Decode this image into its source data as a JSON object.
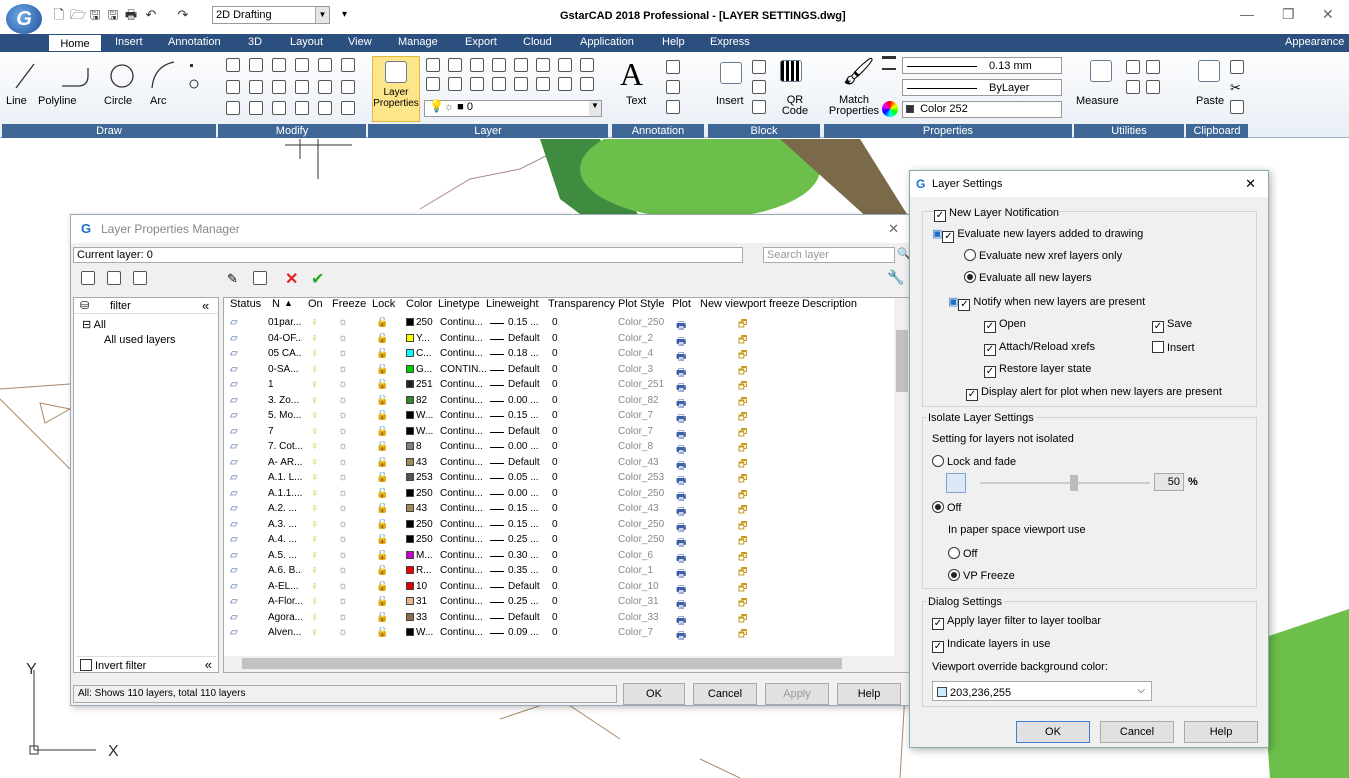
{
  "app": {
    "window_title": "GstarCAD 2018 Professional - [LAYER SETTINGS.dwg]",
    "workspace": "2D Drafting",
    "logo": "G"
  },
  "tabs": [
    "Home",
    "Insert",
    "Annotation",
    "3D",
    "Layout",
    "View",
    "Manage",
    "Export",
    "Cloud",
    "Application",
    "Help",
    "Express"
  ],
  "appearance": "Appearance",
  "ribbon": {
    "draw": {
      "label": "Draw",
      "items": [
        "Line",
        "Polyline",
        "Circle",
        "Arc"
      ]
    },
    "modify": {
      "label": "Modify"
    },
    "layer": {
      "label": "Layer",
      "button": "Layer Properties",
      "layer_value": "0"
    },
    "annotation": {
      "label": "Annotation",
      "text": "Text"
    },
    "block": {
      "label": "Block",
      "insert": "Insert",
      "qr": "QR Code"
    },
    "properties": {
      "label": "Properties",
      "match": "Match Properties",
      "lineweight": "0.13 mm",
      "linetype": "ByLayer",
      "color": "Color 252"
    },
    "utilities": {
      "label": "Utilities",
      "measure": "Measure"
    },
    "clipboard": {
      "label": "Clipboard",
      "paste": "Paste"
    }
  },
  "lpm": {
    "title": "Layer Properties Manager",
    "current_layer": "Current layer: 0",
    "search_placeholder": "Search layer",
    "filter_header": "filter",
    "tree_all": "All",
    "tree_used": "All used layers",
    "invert_filter": "Invert filter",
    "status": "All: Shows 110 layers, total 110 layers",
    "buttons": {
      "ok": "OK",
      "cancel": "Cancel",
      "apply": "Apply",
      "help": "Help"
    },
    "columns": [
      "Status",
      "N",
      "On",
      "Freeze",
      "Lock",
      "Color",
      "Linetype",
      "Lineweight",
      "Transparency",
      "Plot Style",
      "Plot",
      "New viewport freeze",
      "Description"
    ],
    "rows": [
      {
        "name": "01par...",
        "color": "#000000",
        "colorname": "250",
        "linetype": "Continu...",
        "lineweight": "0.15 ...",
        "transparency": "0",
        "plotstyle": "Color_250"
      },
      {
        "name": "04-OF...",
        "color": "#ffff00",
        "colorname": "Y...",
        "linetype": "Continu...",
        "lineweight": "Default",
        "transparency": "0",
        "plotstyle": "Color_2"
      },
      {
        "name": "05 CA...",
        "color": "#00ffff",
        "colorname": "C...",
        "linetype": "Continu...",
        "lineweight": "0.18 ...",
        "transparency": "0",
        "plotstyle": "Color_4"
      },
      {
        "name": "0-SA...",
        "color": "#00cc00",
        "colorname": "G...",
        "linetype": "CONTIN...",
        "lineweight": "Default",
        "transparency": "0",
        "plotstyle": "Color_3"
      },
      {
        "name": "1",
        "color": "#222222",
        "colorname": "251",
        "linetype": "Continu...",
        "lineweight": "Default",
        "transparency": "0",
        "plotstyle": "Color_251"
      },
      {
        "name": "3. Zo...",
        "color": "#2e8b2e",
        "colorname": "82",
        "linetype": "Continu...",
        "lineweight": "0.00 ...",
        "transparency": "0",
        "plotstyle": "Color_82"
      },
      {
        "name": "5. Mo...",
        "color": "#000000",
        "colorname": "W...",
        "linetype": "Continu...",
        "lineweight": "0.15 ...",
        "transparency": "0",
        "plotstyle": "Color_7"
      },
      {
        "name": "7",
        "color": "#000000",
        "colorname": "W...",
        "linetype": "Continu...",
        "lineweight": "Default",
        "transparency": "0",
        "plotstyle": "Color_7"
      },
      {
        "name": "7. Cot...",
        "color": "#808080",
        "colorname": "8",
        "linetype": "Continu...",
        "lineweight": "0.00 ...",
        "transparency": "0",
        "plotstyle": "Color_8"
      },
      {
        "name": "A- AR...",
        "color": "#a08c5a",
        "colorname": "43",
        "linetype": "Continu...",
        "lineweight": "Default",
        "transparency": "0",
        "plotstyle": "Color_43"
      },
      {
        "name": "A.1. L...",
        "color": "#555555",
        "colorname": "253",
        "linetype": "Continu...",
        "lineweight": "0.05 ...",
        "transparency": "0",
        "plotstyle": "Color_253"
      },
      {
        "name": "A.1.1....",
        "color": "#000000",
        "colorname": "250",
        "linetype": "Continu...",
        "lineweight": "0.00 ...",
        "transparency": "0",
        "plotstyle": "Color_250"
      },
      {
        "name": "A.2. ...",
        "color": "#a08c5a",
        "colorname": "43",
        "linetype": "Continu...",
        "lineweight": "0.15 ...",
        "transparency": "0",
        "plotstyle": "Color_43"
      },
      {
        "name": "A.3. ...",
        "color": "#000000",
        "colorname": "250",
        "linetype": "Continu...",
        "lineweight": "0.15 ...",
        "transparency": "0",
        "plotstyle": "Color_250"
      },
      {
        "name": "A.4. ...",
        "color": "#000000",
        "colorname": "250",
        "linetype": "Continu...",
        "lineweight": "0.25 ...",
        "transparency": "0",
        "plotstyle": "Color_250"
      },
      {
        "name": "A.5. ...",
        "color": "#cc00cc",
        "colorname": "M...",
        "linetype": "Continu...",
        "lineweight": "0.30 ...",
        "transparency": "0",
        "plotstyle": "Color_6"
      },
      {
        "name": "A.6. B...",
        "color": "#ee0000",
        "colorname": "R...",
        "linetype": "Continu...",
        "lineweight": "0.35 ...",
        "transparency": "0",
        "plotstyle": "Color_1"
      },
      {
        "name": "A-EL...",
        "color": "#dd0000",
        "colorname": "10",
        "linetype": "Continu...",
        "lineweight": "Default",
        "transparency": "0",
        "plotstyle": "Color_10"
      },
      {
        "name": "A-Flor...",
        "color": "#e8b48a",
        "colorname": "31",
        "linetype": "Continu...",
        "lineweight": "0.25 ...",
        "transparency": "0",
        "plotstyle": "Color_31"
      },
      {
        "name": "Agora...",
        "color": "#8a6a4a",
        "colorname": "33",
        "linetype": "Continu...",
        "lineweight": "Default",
        "transparency": "0",
        "plotstyle": "Color_33"
      },
      {
        "name": "Alven...",
        "color": "#000000",
        "colorname": "W...",
        "linetype": "Continu...",
        "lineweight": "0.09 ...",
        "transparency": "0",
        "plotstyle": "Color_7"
      }
    ]
  },
  "ls": {
    "title": "Layer Settings",
    "new_layer_notification": "New Layer Notification",
    "evaluate_new": "Evaluate new layers added to drawing",
    "evaluate_xref": "Evaluate new xref layers only",
    "evaluate_all": "Evaluate all new layers",
    "notify": "Notify when new layers are present",
    "open": "Open",
    "save": "Save",
    "attach": "Attach/Reload xrefs",
    "insert": "Insert",
    "restore": "Restore layer state",
    "display_alert": "Display alert for plot when new layers are present",
    "isolate_header": "Isolate Layer Settings",
    "setting_not_isolated": "Setting for layers not isolated",
    "lock_fade": "Lock and fade",
    "fade_value": "50",
    "percent": "%",
    "off": "Off",
    "paper_space": "In paper space viewport use",
    "off2": "Off",
    "vp_freeze": "VP Freeze",
    "dialog_header": "Dialog Settings",
    "apply_filter": "Apply layer filter to layer toolbar",
    "indicate": "Indicate layers in use",
    "vp_override": "Viewport override background color:",
    "vp_color": "203,236,255",
    "ok": "OK",
    "cancel": "Cancel",
    "help": "Help"
  }
}
